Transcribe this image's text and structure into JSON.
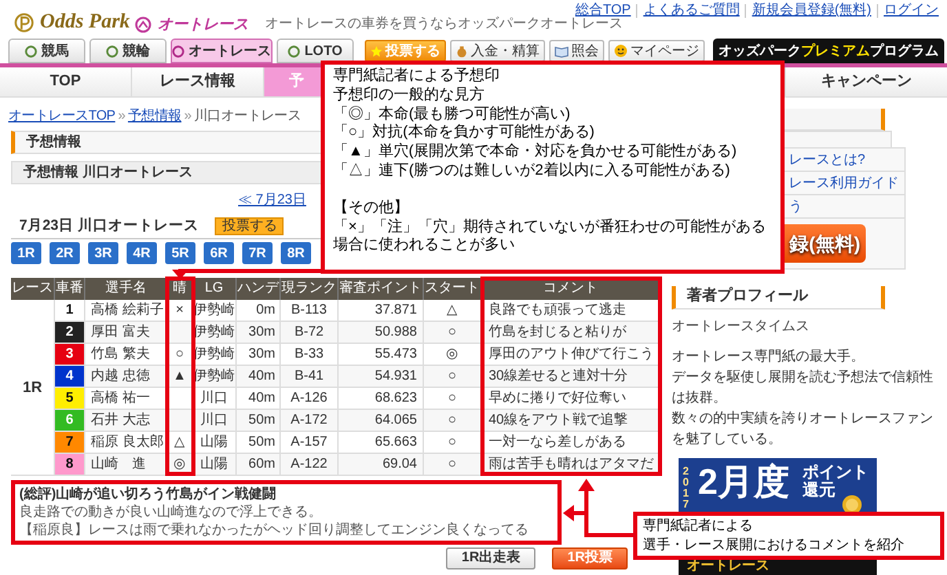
{
  "header": {
    "logo": "Odds Park",
    "sub_logo": "オートレース",
    "tagline": "オートレースの車券を買うならオッズパークオートレース",
    "links": [
      "総合TOP",
      "よくあるご質問",
      "新規会員登録(無料)",
      "ログイン"
    ]
  },
  "product_tabs": [
    {
      "label": "競馬",
      "selected": false
    },
    {
      "label": "競輪",
      "selected": false
    },
    {
      "label": "オートレース",
      "selected": true
    },
    {
      "label": "LOTO",
      "selected": false
    }
  ],
  "account_buttons": [
    {
      "label": "投票する",
      "kind": "vote"
    },
    {
      "label": "入金・精算",
      "kind": "deposit"
    },
    {
      "label": "照会",
      "kind": "inquiry"
    },
    {
      "label": "マイページ",
      "kind": "mypage"
    }
  ],
  "premium_banner": {
    "before": "オッズパーク",
    "highlight": "プレミアム",
    "after": "プログラム"
  },
  "nav_tabs": [
    {
      "label": "TOP",
      "selected": false
    },
    {
      "label": "レース情報",
      "selected": false
    },
    {
      "label": "予",
      "selected": true
    }
  ],
  "nav_tabs_right": [
    {
      "label": "キャンペーン",
      "selected": false
    }
  ],
  "breadcrumb": [
    {
      "text": "オートレースTOP",
      "kind": "link"
    },
    {
      "text": "»",
      "kind": "separator"
    },
    {
      "text": "予想情報",
      "kind": "link"
    },
    {
      "text": "»",
      "kind": "separator"
    },
    {
      "text": "川口オートレース",
      "kind": "current"
    }
  ],
  "section_title": "予想情報",
  "subheading": "予想情報 川口オートレース",
  "date_nav": "≪ 7月23日",
  "race_header": {
    "title": "7月23日 川口オートレース",
    "vote_button": "投票する"
  },
  "race_buttons": [
    "1R",
    "2R",
    "3R",
    "4R",
    "5R",
    "6R",
    "7R",
    "8R"
  ],
  "table": {
    "columns": [
      "レース",
      "車番",
      "選手名",
      "晴",
      "LG",
      "ハンデ",
      "現ランク",
      "審査ポイント",
      "スタート",
      "コメント"
    ],
    "race": "1R",
    "rows": [
      {
        "number": "1",
        "color": "#ffffff",
        "name": "高橋 絵莉子",
        "mark": "×",
        "lg": "伊勢崎",
        "handicap": "0m",
        "rank": "B-113",
        "points": "37.871",
        "start": "△",
        "comment": "良路でも頑張って逃走"
      },
      {
        "number": "2",
        "color": "#222222",
        "name": "厚田 富夫",
        "lg": "伊勢崎",
        "handicap": "30m",
        "rank": "B-72",
        "points": "50.988",
        "start": "○",
        "comment": "竹島を封じると粘りが"
      },
      {
        "number": "3",
        "color": "#e60012",
        "name": "竹島 繁夫",
        "mark": "○",
        "lg": "伊勢崎",
        "handicap": "30m",
        "rank": "B-33",
        "points": "55.473",
        "start": "◎",
        "comment": "厚田のアウト伸びて行こう"
      },
      {
        "number": "4",
        "color": "#0033cc",
        "name": "内越 忠徳",
        "mark": "▲",
        "lg": "伊勢崎",
        "handicap": "40m",
        "rank": "B-41",
        "points": "54.931",
        "start": "○",
        "comment": "30線差せると連対十分"
      },
      {
        "number": "5",
        "color": "#ffee00",
        "name": "高橋 祐一",
        "lg": "川口",
        "handicap": "40m",
        "rank": "A-126",
        "points": "68.623",
        "start": "○",
        "comment": "早めに捲りで好位奪い"
      },
      {
        "number": "6",
        "color": "#33bb22",
        "name": "石井 大志",
        "lg": "川口",
        "handicap": "50m",
        "rank": "A-172",
        "points": "64.065",
        "start": "○",
        "comment": "40線をアウト戦で追撃"
      },
      {
        "number": "7",
        "color": "#ff8800",
        "name": "稲原 良太郎",
        "mark": "△",
        "lg": "山陽",
        "handicap": "50m",
        "rank": "A-157",
        "points": "65.663",
        "start": "○",
        "comment": "一対一なら差しがある"
      },
      {
        "number": "8",
        "color": "#ff99cc",
        "name": "山崎　進",
        "mark": "◎",
        "lg": "山陽",
        "handicap": "60m",
        "rank": "A-122",
        "points": "69.04",
        "start": "○",
        "comment": "雨は苦手も晴れはアタマだ"
      }
    ]
  },
  "summary": {
    "title": "(総評)山崎が追い切ろう竹島がイン戦健闘",
    "lines": [
      "良走路での動きが良い山崎進なので浮上できる。",
      "【稲原良】レースは雨で乗れなかったがヘッド回り調整してエンジン良くなってる"
    ]
  },
  "bottom_buttons": [
    {
      "label": "1R出走表",
      "kind": "plain"
    },
    {
      "label": "1R投票",
      "kind": "vote"
    }
  ],
  "sidebar": {
    "links": [
      "レースとは?",
      "レース利用ガイド",
      "う"
    ],
    "register_button": "録(無料)",
    "profile_title": "著者プロフィール",
    "author": "オートレースタイムス",
    "bio": [
      "オートレース専門紙の最大手。",
      "データを駆使し展開を読む予想法で信頼性は抜群。",
      "数々の的中実績を誇りオートレースファンを魅了している。"
    ],
    "banner": {
      "year": "2017",
      "month": "2月度",
      "lines": [
        "ポイント",
        "還元"
      ],
      "footer": "オートレース"
    }
  },
  "callouts": [
    {
      "paragraphs": [
        [
          "専門紙記者による予想印",
          "予想印の一般的な見方",
          "「◎」本命(最も勝つ可能性が高い)",
          "「○」対抗(本命を負かす可能性がある)",
          "「▲」単穴(展開次第で本命・対応を負かせる可能性がある)",
          "「△」連下(勝つのは難しいが2着以内に入る可能性がある)"
        ],
        [
          "【その他】",
          "「×」「注」「穴」期待されていないが番狂わせの可能性がある場合に使われることが多い"
        ]
      ]
    },
    {
      "paragraphs": [
        [
          "専門紙記者による",
          "選手・レース展開におけるコメントを紹介"
        ]
      ]
    }
  ]
}
